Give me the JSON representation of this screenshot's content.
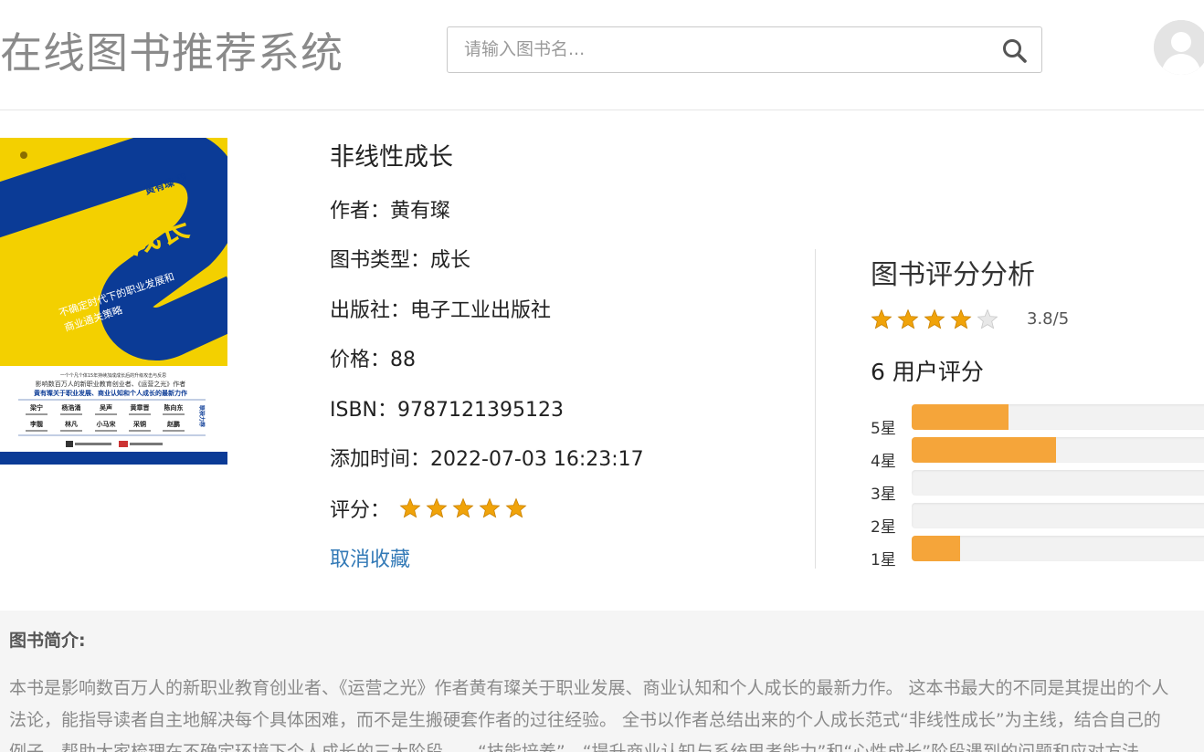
{
  "header": {
    "site_title": "在线图书推荐系统",
    "search_placeholder": "请输入图书名..."
  },
  "icons": {
    "search": "search-icon",
    "avatar": "user-avatar-icon",
    "star_full": "star-icon",
    "star_empty": "star-empty-icon"
  },
  "colors": {
    "accent_link": "#337ab7",
    "star": "#f0a30a",
    "bar_fill": "#f5a53a",
    "cover_yellow": "#f3d000",
    "cover_blue": "#0b3b96"
  },
  "book": {
    "title": "非线性成长",
    "author_label": "作者：",
    "author": "黄有璨",
    "category_label": "图书类型：",
    "category": "成长",
    "publisher_label": "出版社：",
    "publisher": "电子工业出版社",
    "price_label": "价格：",
    "price": "88",
    "isbn_label": "ISBN：",
    "isbn": "9787121395123",
    "added_label": "添加时间：",
    "added_time": "2022-07-03 16:23:17",
    "rating_label": "评分：",
    "user_rating_stars": 5,
    "unfavorite_label": "取消收藏"
  },
  "cover": {
    "title": "非线性成长",
    "author_line": "黄有璨 著",
    "subtitle_line1": "不确定时代下的职业发展和",
    "subtitle_line2": "商业通关策略",
    "blurb1": "一个个凡个体15年持续加成成长后的升级攻击与反思",
    "blurb2": "影响数百万人的新职业教育创业者、《运营之光》作者",
    "blurb3": "黄有璨关于职业发展、商业认知和个人成长的最新力作",
    "recommenders_row1": [
      "梁宁",
      "杨浩涌",
      "吴声",
      "黄章晋",
      "陈向东"
    ],
    "recommenders_row2": [
      "李靓",
      "林凡",
      "小马宋",
      "采铜",
      "赵鹏"
    ],
    "recommend_tag": "联袂力荐"
  },
  "rating_panel": {
    "title": "图书评分分析",
    "average": 3.8,
    "average_text": "3.8/5",
    "users_text": "6 用户评分",
    "distribution": [
      {
        "label": "5星",
        "fraction": 0.32
      },
      {
        "label": "4星",
        "fraction": 0.48
      },
      {
        "label": "3星",
        "fraction": 0
      },
      {
        "label": "2星",
        "fraction": 0
      },
      {
        "label": "1星",
        "fraction": 0.16
      }
    ]
  },
  "intro": {
    "title": "图书简介:",
    "lines": [
      "本书是影响数百万人的新职业教育创业者、《运营之光》作者黄有璨关于职业发展、商业认知和个人成长的最新力作。 这本书最大的不同是其提出的个人",
      "法论，能指导读者自主地解决每个具体困难，而不是生搬硬套作者的过往经验。 全书以作者总结出来的个人成长范式“非线性成长”为主线，结合自己的",
      "例子，帮助大家梳理在不确定环境下个人成长的三大阶段——“技能培养”、“提升商业认知与系统思考能力”和“心性成长”阶段遇到的问题和应对方法"
    ]
  }
}
